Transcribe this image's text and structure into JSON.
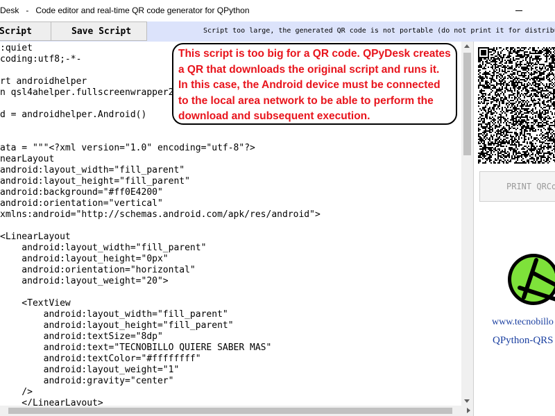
{
  "window": {
    "title": "Desk   -   Code editor and real-time QR code generator for QPython"
  },
  "toolbar": {
    "run_label": "Script",
    "save_label": "Save Script",
    "status": "Script too large, the generated QR code is not portable (do not print it for distribution)"
  },
  "editor": {
    "lines": [
      ":quiet",
      "coding:utf8;-*-",
      "",
      "rt androidhelper",
      "n qsl4ahelper.fullscreenwrapper2",
      "",
      "d = androidhelper.Android()",
      "",
      "",
      "ata = \"\"\"<?xml version=\"1.0\" encoding=\"utf-8\"?>",
      "nearLayout",
      "android:layout_width=\"fill_parent\"",
      "android:layout_height=\"fill_parent\"",
      "android:background=\"#ff0E4200\"",
      "android:orientation=\"vertical\"",
      "xmlns:android=\"http://schemas.android.com/apk/res/android\">",
      "",
      "<LinearLayout",
      "    android:layout_width=\"fill_parent\"",
      "    android:layout_height=\"0px\"",
      "    android:orientation=\"horizontal\"",
      "    android:layout_weight=\"20\">",
      "",
      "    <TextView",
      "        android:layout_width=\"fill_parent\"",
      "        android:layout_height=\"fill_parent\"",
      "        android:textSize=\"8dp\"",
      "        android:text=\"TECNOBILLO QUIERE SABER MAS\"",
      "        android:textColor=\"#ffffffff\"",
      "        android:layout_weight=\"1\"",
      "        android:gravity=\"center\"",
      "    />",
      "    </LinearLayout>"
    ]
  },
  "callout": {
    "lines": [
      "This script is too big for a QR code. QPyDesk creates",
      "a QR that downloads the original script and runs it.",
      "In this case, the Android device must be connected",
      "to the local area network to be able to perform the",
      "download and subsequent execution."
    ],
    "color": "#e8141c"
  },
  "sidebar": {
    "print_label": "PRINT QRCo",
    "site_url": "www.tecnobillo",
    "app_link": "QPython-QRS"
  },
  "colors": {
    "toolbar_bg": "#dce3fb",
    "logo_green": "#7ee23a",
    "link_blue": "#1a3fa0"
  }
}
